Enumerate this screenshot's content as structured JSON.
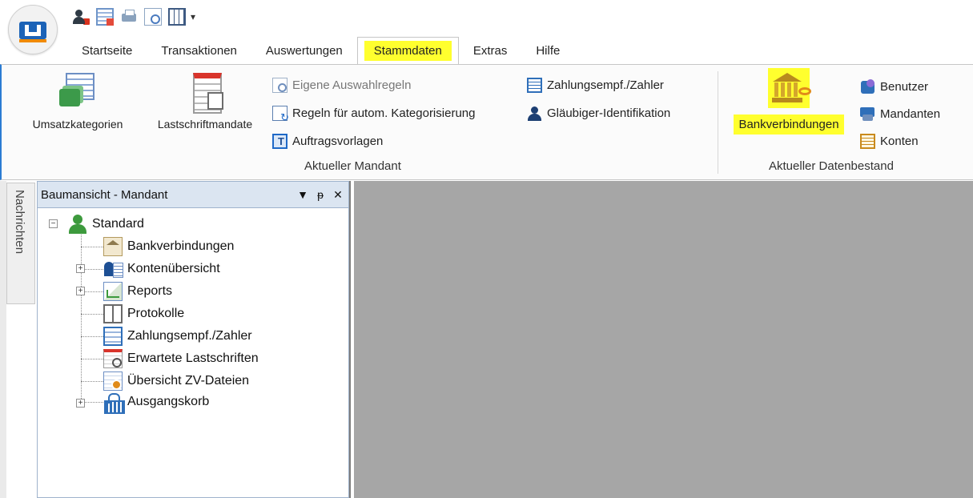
{
  "qat": {
    "icons": [
      "user-delete-icon",
      "table-delete-icon",
      "print-icon",
      "print-preview-icon",
      "table-settings-icon"
    ],
    "caret": "▾"
  },
  "tabs": [
    "Startseite",
    "Transaktionen",
    "Auswertungen",
    "Stammdaten",
    "Extras",
    "Hilfe"
  ],
  "active_tab": "Stammdaten",
  "ribbon": {
    "aktueller_mandant": {
      "label": "Aktueller Mandant",
      "big_buttons": [
        "Umsatzkategorien",
        "Lastschriftmandate"
      ],
      "small_buttons_col1": [
        "Eigene Auswahlregeln",
        "Regeln für autom. Kategorisierung",
        "Auftragsvorlagen"
      ],
      "small_buttons_col2": [
        "Zahlungsempf./Zahler",
        "Gläubiger-Identifikation"
      ]
    },
    "aktueller_datenbestand": {
      "label": "Aktueller Datenbestand",
      "big_button": "Bankverbindungen",
      "small_buttons": [
        "Benutzer",
        "Mandanten",
        "Konten"
      ]
    }
  },
  "side_tab": "Nachrichten",
  "tree_panel": {
    "title": "Baumansicht - Mandant",
    "controls": [
      "▼",
      "ᵽ",
      "✕"
    ],
    "root": "Standard",
    "items": [
      "Bankverbindungen",
      "Kontenübersicht",
      "Reports",
      "Protokolle",
      "Zahlungsempf./Zahler",
      "Erwartete Lastschriften",
      "Übersicht ZV-Dateien",
      "Ausgangskorb"
    ],
    "expand_symbol_open": "−",
    "expand_symbol_closed": "+"
  },
  "colors": {
    "highlight": "#ffff2e",
    "ribbon_border": "#2b7cd3",
    "workspace": "#a6a6a6",
    "tree_header": "#dbe5f1"
  }
}
